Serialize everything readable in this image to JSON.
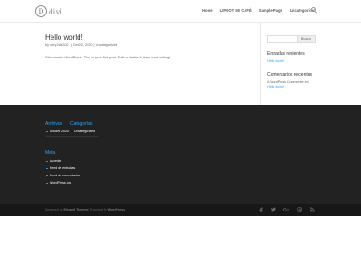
{
  "header": {
    "logo_letter": "D",
    "logo_text": "divi",
    "nav": [
      "Home",
      "LIPOOT DE CAFÉ",
      "Sample Page",
      "Uncategorized"
    ]
  },
  "post": {
    "title": "Hello world!",
    "meta": "by dery2LA2021 | Oct 22, 2020 | Uncategorized",
    "body": "Welcome to WordPress. This is your first post. Edit or delete it, then start writing!"
  },
  "sidebar": {
    "search_button": "Buscar",
    "recent_posts_heading": "Entradas recientes",
    "recent_post": "Hello world!",
    "recent_comments_heading": "Comentarios recientes",
    "comment_line1": "A WordPress Commenter en",
    "comment_line2": "Hello world!"
  },
  "footer": {
    "archives_heading": "Archivos",
    "archives_item": "octubre 2020",
    "categories_heading": "Categorías",
    "categories_item": "Uncategorized",
    "meta_heading": "Meta",
    "meta_items": [
      "Acceder",
      "Feed de entradas",
      "Feed de comentarios",
      "WordPress.org"
    ],
    "credits_designed": "Designed by",
    "credits_elegant": "Elegant Themes",
    "credits_mid": "| Powered by",
    "credits_wp": "WordPress"
  },
  "colors": {
    "accent": "#2ea3f2",
    "footer_bg": "#222222",
    "bottom_bg": "#171717"
  },
  "social_icons": [
    "facebook-icon",
    "twitter-icon",
    "google-plus-icon",
    "instagram-icon",
    "rss-icon"
  ]
}
